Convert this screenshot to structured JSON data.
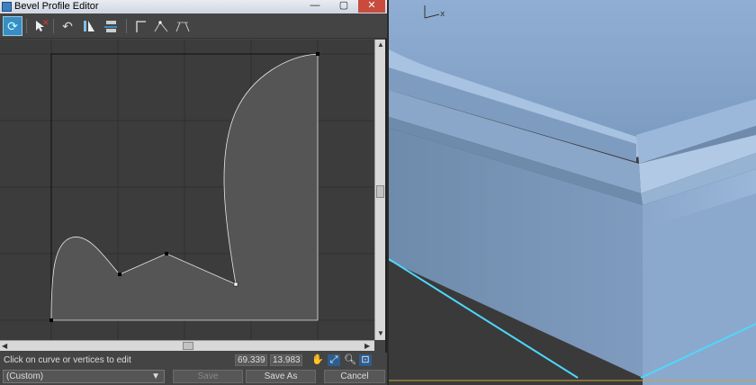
{
  "window": {
    "title": "Bevel Profile Editor"
  },
  "window_controls": {
    "minimize": "—",
    "restore": "▢",
    "close": "✕"
  },
  "toolbar": {
    "icons": [
      "refresh-icon",
      "delete-point-icon",
      "undo-icon",
      "mirror-icon",
      "align-icon",
      "corner-point-icon",
      "smooth-point-icon",
      "bezier-point-icon"
    ]
  },
  "status": {
    "hint": "Click on curve or vertices to edit",
    "x_value": "69.339",
    "y_value": "13.983"
  },
  "bottom": {
    "preset": "(Custom)",
    "save_label": "Save",
    "save_as_label": "Save As",
    "cancel_label": "Cancel"
  },
  "viewport": {
    "axis_label": "x"
  },
  "colors": {
    "accent": "#3a8cc4",
    "selection": "#4fd7ff",
    "model": "#8ea8c8"
  }
}
